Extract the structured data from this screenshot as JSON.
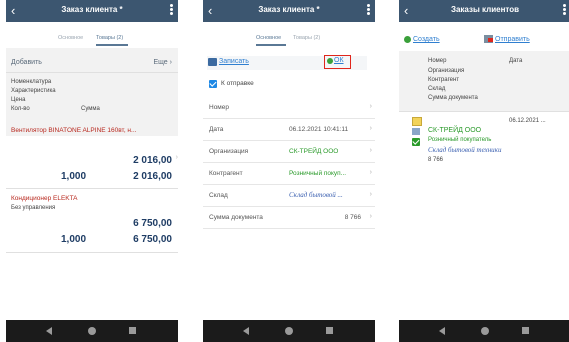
{
  "screens": [
    {
      "title": "Заказ клиента *",
      "tabs": [
        "Основное",
        "Товары (2)"
      ],
      "toolbar": {
        "add": "Добавить",
        "more": "Еще"
      },
      "columns": {
        "nomenclature": "Номенклатура",
        "characteristic": "Характеристика",
        "price": "Цена",
        "quantity": "Кол-во",
        "sum": "Сумма"
      },
      "items": [
        {
          "name": "Вентилятор BINATONE ALPINE 160вт, н...",
          "characteristic": "",
          "price": "2 016,00",
          "quantity": "1,000",
          "sum": "2 016,00"
        },
        {
          "name": "Кондиционер ELEKTA",
          "characteristic": "Без управления",
          "price": "6 750,00",
          "quantity": "1,000",
          "sum": "6 750,00"
        }
      ]
    },
    {
      "title": "Заказ клиента *",
      "tabs": [
        "Основное",
        "Товары (2)"
      ],
      "toolbar": {
        "save": "Записать",
        "ok": "ОК"
      },
      "checkbox_label": "К отправке",
      "fields": [
        {
          "label": "Номер",
          "value": ""
        },
        {
          "label": "Дата",
          "value": "06.12.2021 10:41:11"
        },
        {
          "label": "Организация",
          "value": "СК-ТРЕЙД ООО"
        },
        {
          "label": "Контрагент",
          "value": "Розничный покуп..."
        },
        {
          "label": "Склад",
          "value": "Склад бытовой ..."
        },
        {
          "label": "Сумма документа",
          "value": "8 766"
        }
      ]
    },
    {
      "title": "Заказы клиентов",
      "toolbar": {
        "create": "Создать",
        "send": "Отправить"
      },
      "columns": {
        "number": "Номер",
        "date": "Дата",
        "organization": "Организация",
        "counterparty": "Контрагент",
        "warehouse": "Склад",
        "sum": "Сумма документа"
      },
      "orders": [
        {
          "number": "",
          "date": "06.12.2021 ...",
          "organization": "СК-ТРЕЙД ООО",
          "counterparty": "Розничный покупатель",
          "warehouse": "Склад бытовой техники",
          "sum": "8 766"
        }
      ]
    }
  ],
  "colors": {
    "topbar": "#3c5670",
    "link": "#2f7fd0",
    "item_red": "#b8281e",
    "org_green": "#2a9a2a",
    "ok_highlight": "#e0261c",
    "navbar": "#1b1b1b"
  },
  "icons": {
    "back": "‹",
    "more_chevron": "›"
  }
}
